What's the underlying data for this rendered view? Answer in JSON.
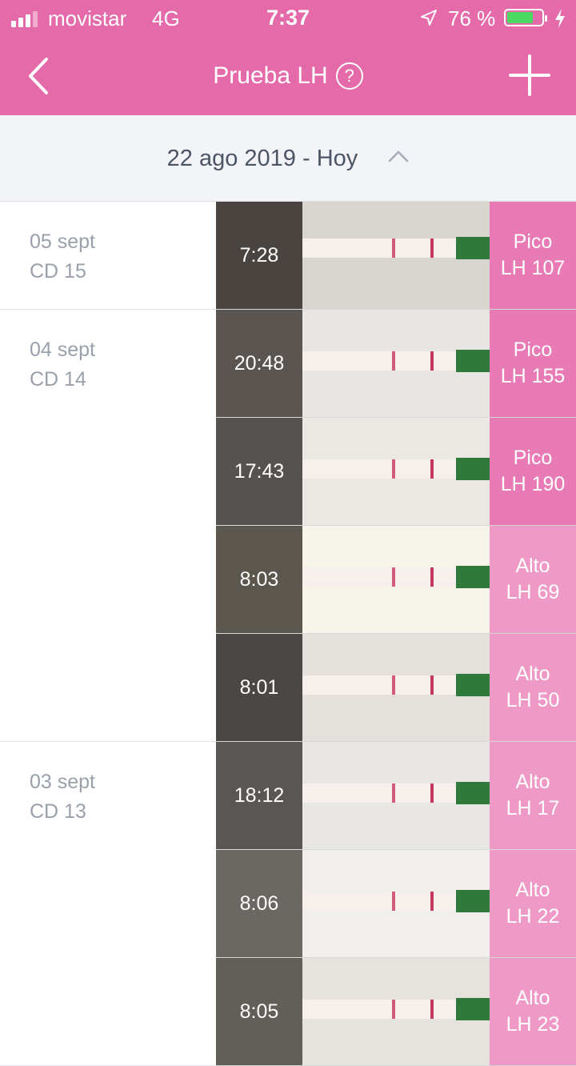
{
  "status_bar": {
    "carrier": "movistar",
    "network": "4G",
    "time": "7:37",
    "battery_percent": "76 %",
    "battery_level": 0.76
  },
  "nav": {
    "title": "Prueba LH",
    "help_glyph": "?",
    "back_icon": "chevron-left-icon",
    "add_icon": "plus-icon"
  },
  "range": {
    "label": "22 ago 2019 - Hoy",
    "toggle_icon": "chevron-up-icon"
  },
  "colors": {
    "header": "#e46aaa",
    "result_pico": "#e87ab5",
    "result_alto": "#ef9ac6"
  },
  "days": [
    {
      "date": "05 sept",
      "cycle_day": "CD 15",
      "entries": [
        {
          "time": "7:28",
          "level": "Pico",
          "value": "LH 107"
        }
      ]
    },
    {
      "date": "04 sept",
      "cycle_day": "CD 14",
      "entries": [
        {
          "time": "20:48",
          "level": "Pico",
          "value": "LH 155"
        },
        {
          "time": "17:43",
          "level": "Pico",
          "value": "LH 190"
        },
        {
          "time": "8:03",
          "level": "Alto",
          "value": "LH 69"
        },
        {
          "time": "8:01",
          "level": "Alto",
          "value": "LH 50"
        }
      ]
    },
    {
      "date": "03 sept",
      "cycle_day": "CD 13",
      "entries": [
        {
          "time": "18:12",
          "level": "Alto",
          "value": "LH 17"
        },
        {
          "time": "8:06",
          "level": "Alto",
          "value": "LH 22"
        },
        {
          "time": "8:05",
          "level": "Alto",
          "value": "LH 23"
        }
      ]
    }
  ]
}
